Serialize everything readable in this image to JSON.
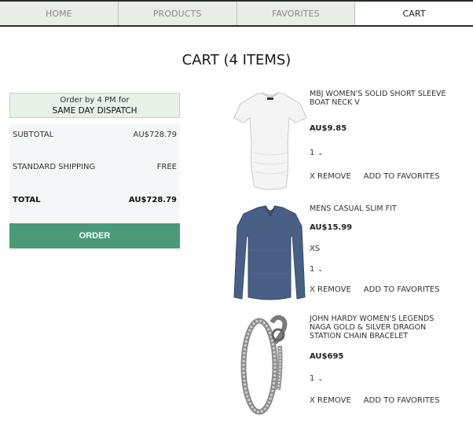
{
  "nav": {
    "tabs": [
      {
        "label": "HOME"
      },
      {
        "label": "PRODUCTS"
      },
      {
        "label": "FAVORITES"
      },
      {
        "label": "CART"
      }
    ],
    "active": "CART"
  },
  "page": {
    "title": "CART (4 ITEMS)"
  },
  "summary": {
    "dispatch_line1": "Order by 4 PM for",
    "dispatch_line2": "SAME DAY DISPATCH",
    "subtotal_label": "SUBTOTAL",
    "subtotal_value": "AU$728.79",
    "shipping_label": "STANDARD SHIPPING",
    "shipping_value": "FREE",
    "total_label": "TOTAL",
    "total_value": "AU$728.79",
    "order_label": "ORDER"
  },
  "items": [
    {
      "name": "MBJ WOMEN'S SOLID SHORT SLEEVE BOAT NECK V",
      "price": "AU$9.85",
      "size": "",
      "qty": "1",
      "remove_label": "X REMOVE",
      "favorite_label": "ADD TO FAVORITES",
      "image_icon": "white-tshirt-icon"
    },
    {
      "name": "MENS CASUAL SLIM FIT",
      "price": "AU$15.99",
      "size": "XS",
      "qty": "1",
      "remove_label": "X REMOVE",
      "favorite_label": "ADD TO FAVORITES",
      "image_icon": "blue-longsleeve-icon"
    },
    {
      "name": "JOHN HARDY WOMEN'S LEGENDS NAGA GOLD & SILVER DRAGON STATION CHAIN BRACELET",
      "price": "AU$695",
      "size": "",
      "qty": "1",
      "remove_label": "X REMOVE",
      "favorite_label": "ADD TO FAVORITES",
      "image_icon": "dragon-bracelet-icon"
    }
  ],
  "colors": {
    "nav_bg": "#e8eee6",
    "dispatch_bg": "#e6f2e8",
    "order_button": "#4a9a78"
  }
}
